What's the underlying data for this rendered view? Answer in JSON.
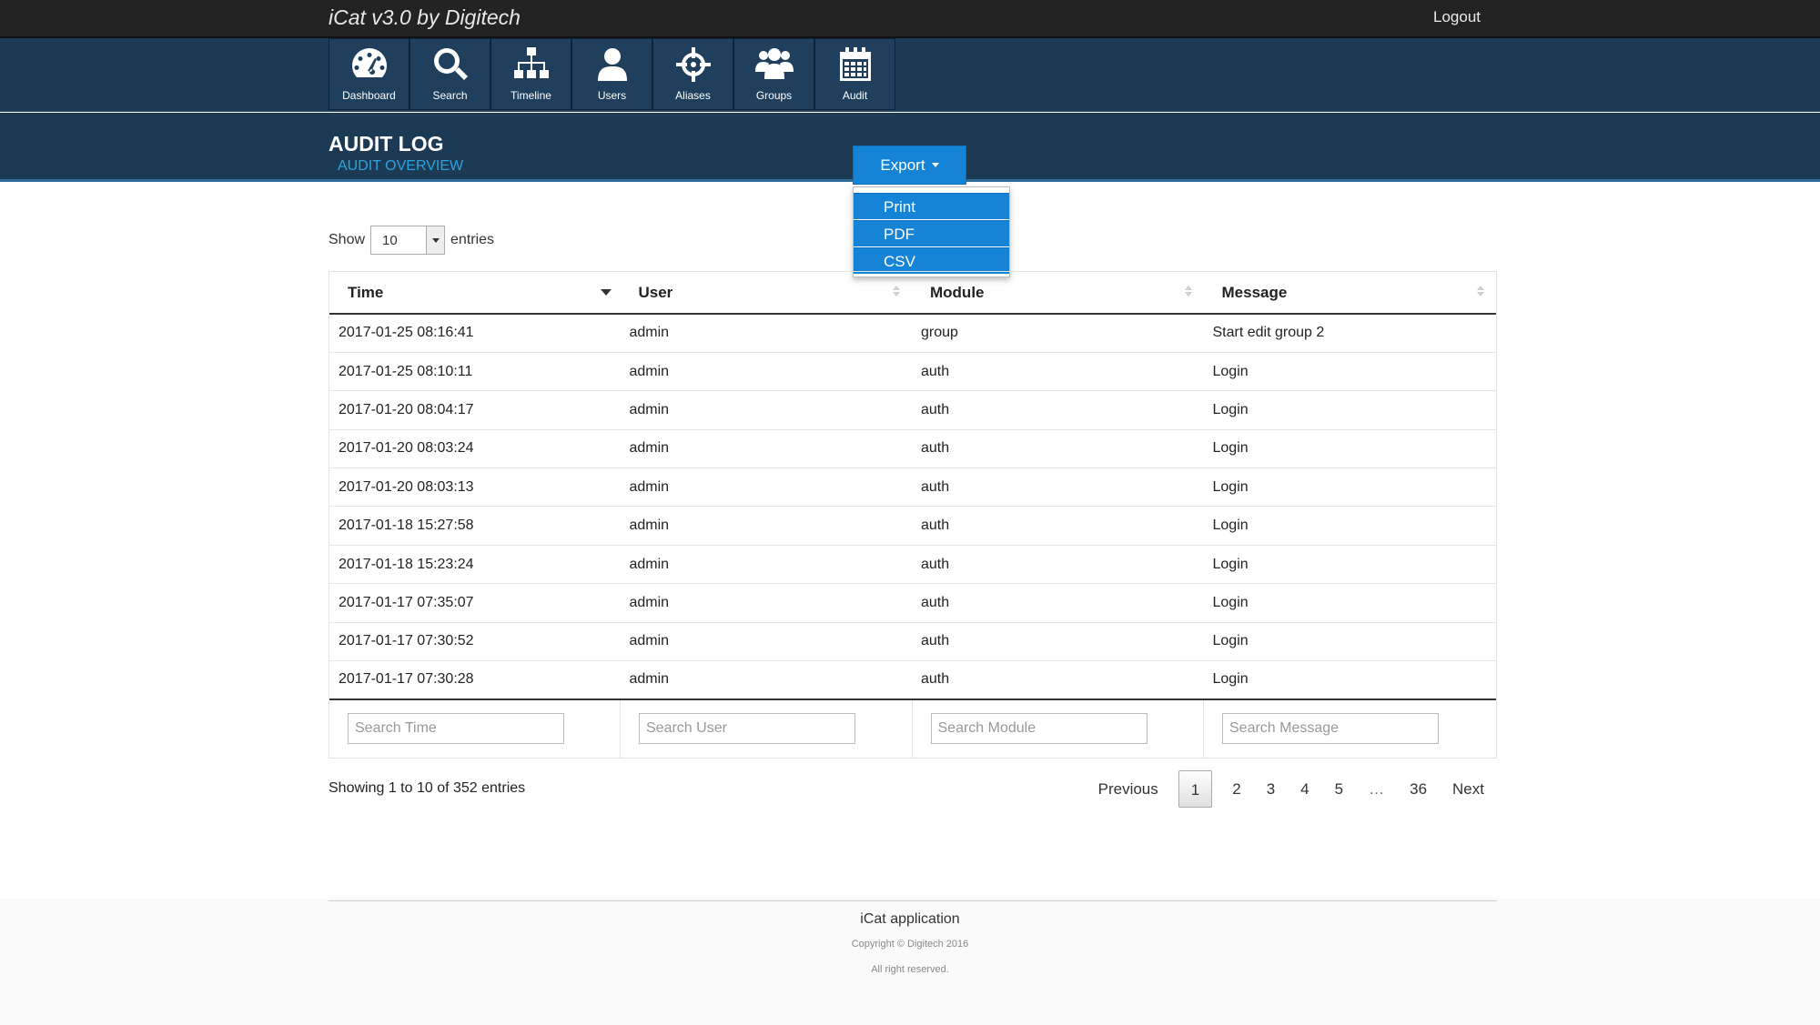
{
  "app": {
    "title": "iCat v3.0 by Digitech",
    "logout_label": "Logout"
  },
  "nav": {
    "items": [
      {
        "label": "Dashboard",
        "icon": "dashboard-icon"
      },
      {
        "label": "Search",
        "icon": "search-icon"
      },
      {
        "label": "Timeline",
        "icon": "sitemap-icon"
      },
      {
        "label": "Users",
        "icon": "user-icon"
      },
      {
        "label": "Aliases",
        "icon": "crosshair-icon"
      },
      {
        "label": "Groups",
        "icon": "group-icon"
      },
      {
        "label": "Audit",
        "icon": "calendar-icon"
      }
    ]
  },
  "page": {
    "title": "AUDIT LOG",
    "subtitle": "AUDIT OVERVIEW"
  },
  "export": {
    "label": "Export",
    "options": [
      "Print",
      "PDF",
      "CSV"
    ]
  },
  "length": {
    "show_label": "Show",
    "value": "10",
    "entries_label": "entries"
  },
  "table": {
    "columns": [
      "Time",
      "User",
      "Module",
      "Message"
    ],
    "rows": [
      [
        "2017-01-25 08:16:41",
        "admin",
        "group",
        "Start edit group 2"
      ],
      [
        "2017-01-25 08:10:11",
        "admin",
        "auth",
        "Login"
      ],
      [
        "2017-01-20 08:04:17",
        "admin",
        "auth",
        "Login"
      ],
      [
        "2017-01-20 08:03:24",
        "admin",
        "auth",
        "Login"
      ],
      [
        "2017-01-20 08:03:13",
        "admin",
        "auth",
        "Login"
      ],
      [
        "2017-01-18 15:27:58",
        "admin",
        "auth",
        "Login"
      ],
      [
        "2017-01-18 15:23:24",
        "admin",
        "auth",
        "Login"
      ],
      [
        "2017-01-17 07:35:07",
        "admin",
        "auth",
        "Login"
      ],
      [
        "2017-01-17 07:30:52",
        "admin",
        "auth",
        "Login"
      ],
      [
        "2017-01-17 07:30:28",
        "admin",
        "auth",
        "Login"
      ]
    ],
    "search_placeholders": [
      "Search Time",
      "Search User",
      "Search Module",
      "Search Message"
    ]
  },
  "info": "Showing 1 to 10 of 352 entries",
  "pagination": {
    "previous": "Previous",
    "pages": [
      "1",
      "2",
      "3",
      "4",
      "5",
      "…",
      "36"
    ],
    "current": "1",
    "next": "Next"
  },
  "footer": {
    "title": "iCat application",
    "copyright": "Copyright © Digitech 2016",
    "rights": "All right reserved."
  },
  "colors": {
    "topbar": "#232323",
    "nav": "#1d3a55",
    "accent": "#1584d6",
    "subtitle": "#2aa3e0"
  }
}
